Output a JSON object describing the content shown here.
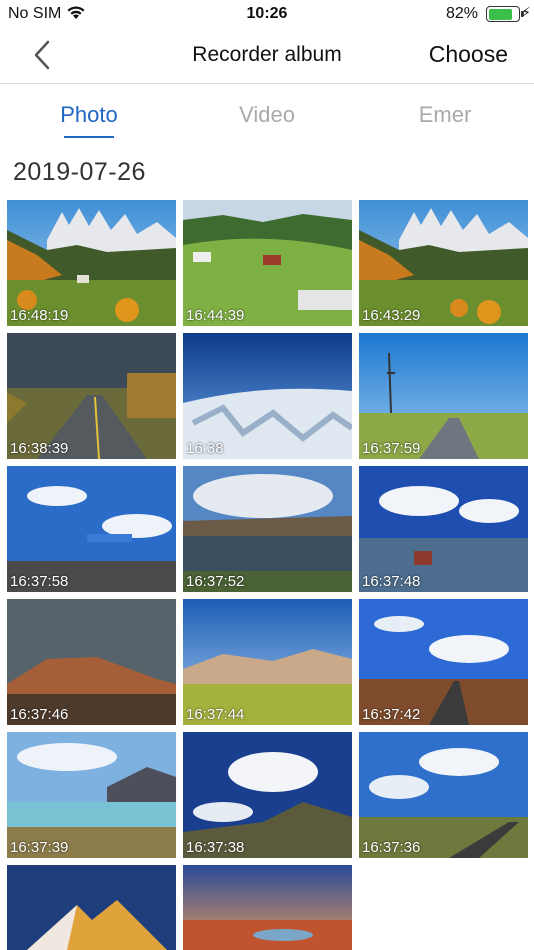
{
  "status": {
    "carrier": "No SIM",
    "time": "10:26",
    "battery": "82%",
    "battery_level": 0.82
  },
  "nav": {
    "title": "Recorder album",
    "choose": "Choose"
  },
  "tabs": [
    {
      "label": "Photo",
      "active": true
    },
    {
      "label": "Video",
      "active": false
    },
    {
      "label": "Emer",
      "active": false
    }
  ],
  "group": {
    "date": "2019-07-26",
    "photos": [
      {
        "time": "16:48:19"
      },
      {
        "time": "16:44:39"
      },
      {
        "time": "16:43:29"
      },
      {
        "time": "16:38:39"
      },
      {
        "time": "16:38"
      },
      {
        "time": "16:37:59"
      },
      {
        "time": "16:37:58"
      },
      {
        "time": "16:37:52"
      },
      {
        "time": "16:37:48"
      },
      {
        "time": "16:37:46"
      },
      {
        "time": "16:37:44"
      },
      {
        "time": "16:37:42"
      },
      {
        "time": "16:37:39"
      },
      {
        "time": "16:37:38"
      },
      {
        "time": "16:37:36"
      },
      {
        "time": ""
      },
      {
        "time": ""
      }
    ]
  },
  "colors": {
    "accent": "#2266c4",
    "inactive_tab": "#aaaaaa",
    "battery": "#3ac04a"
  }
}
